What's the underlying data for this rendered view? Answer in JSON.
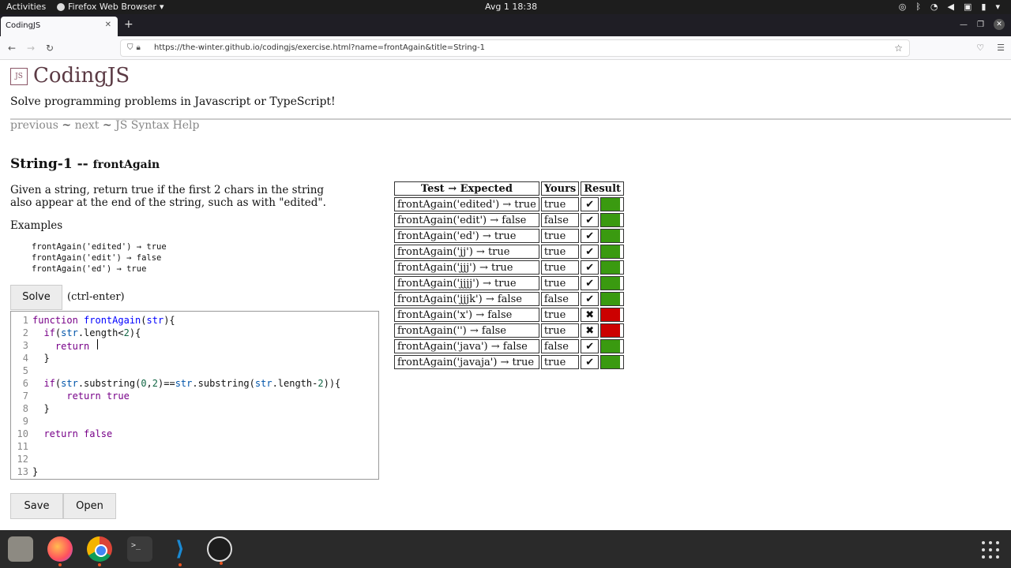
{
  "system_bar": {
    "activities": "Activities",
    "app_name": "Firefox Web Browser",
    "clock": "Avg 1  18:38"
  },
  "browser": {
    "tab_title": "CodingJS",
    "url": "https://the-winter.github.io/codingjs/exercise.html?name=frontAgain&title=String-1"
  },
  "site": {
    "title": "CodingJS",
    "tagline": "Solve programming problems in Javascript or TypeScript!",
    "nav": {
      "previous": "previous",
      "sep1": " ~ ",
      "next": "next",
      "sep2": " ~ ",
      "help": "JS Syntax Help"
    }
  },
  "problem": {
    "category": "String-1 -- ",
    "name": "frontAgain",
    "description": "Given a string, return true if the first 2 chars in the string also appear at the end of the string, such as with \"edited\".",
    "examples_heading": "Examples",
    "examples": [
      "frontAgain('edited') → true",
      "frontAgain('edit') → false",
      "frontAgain('ed') → true"
    ]
  },
  "controls": {
    "solve": "Solve",
    "shortcut": "(ctrl-enter)",
    "save": "Save",
    "open": "Open"
  },
  "editor": {
    "line_numbers": [
      "1",
      "2",
      "3",
      "4",
      "5",
      "6",
      "7",
      "8",
      "9",
      "10",
      "11",
      "12",
      "13"
    ]
  },
  "results": {
    "headers": [
      "Test → Expected",
      "Yours",
      "Result"
    ],
    "rows": [
      {
        "test": "frontAgain('edited') → true",
        "yours": "true",
        "mark": "✔",
        "status": "pass"
      },
      {
        "test": "frontAgain('edit') → false",
        "yours": "false",
        "mark": "✔",
        "status": "pass"
      },
      {
        "test": "frontAgain('ed') → true",
        "yours": "true",
        "mark": "✔",
        "status": "pass"
      },
      {
        "test": "frontAgain('jj') → true",
        "yours": "true",
        "mark": "✔",
        "status": "pass"
      },
      {
        "test": "frontAgain('jjj') → true",
        "yours": "true",
        "mark": "✔",
        "status": "pass"
      },
      {
        "test": "frontAgain('jjjj') → true",
        "yours": "true",
        "mark": "✔",
        "status": "pass"
      },
      {
        "test": "frontAgain('jjjk') → false",
        "yours": "false",
        "mark": "✔",
        "status": "pass"
      },
      {
        "test": "frontAgain('x') → false",
        "yours": "true",
        "mark": "✖",
        "status": "fail"
      },
      {
        "test": "frontAgain('') → false",
        "yours": "true",
        "mark": "✖",
        "status": "fail"
      },
      {
        "test": "frontAgain('java') → false",
        "yours": "false",
        "mark": "✔",
        "status": "pass"
      },
      {
        "test": "frontAgain('javaja') → true",
        "yours": "true",
        "mark": "✔",
        "status": "pass"
      }
    ]
  },
  "colors": {
    "pass": "#3a9a10",
    "fail": "#cc0000",
    "brand": "#5b3a44"
  }
}
